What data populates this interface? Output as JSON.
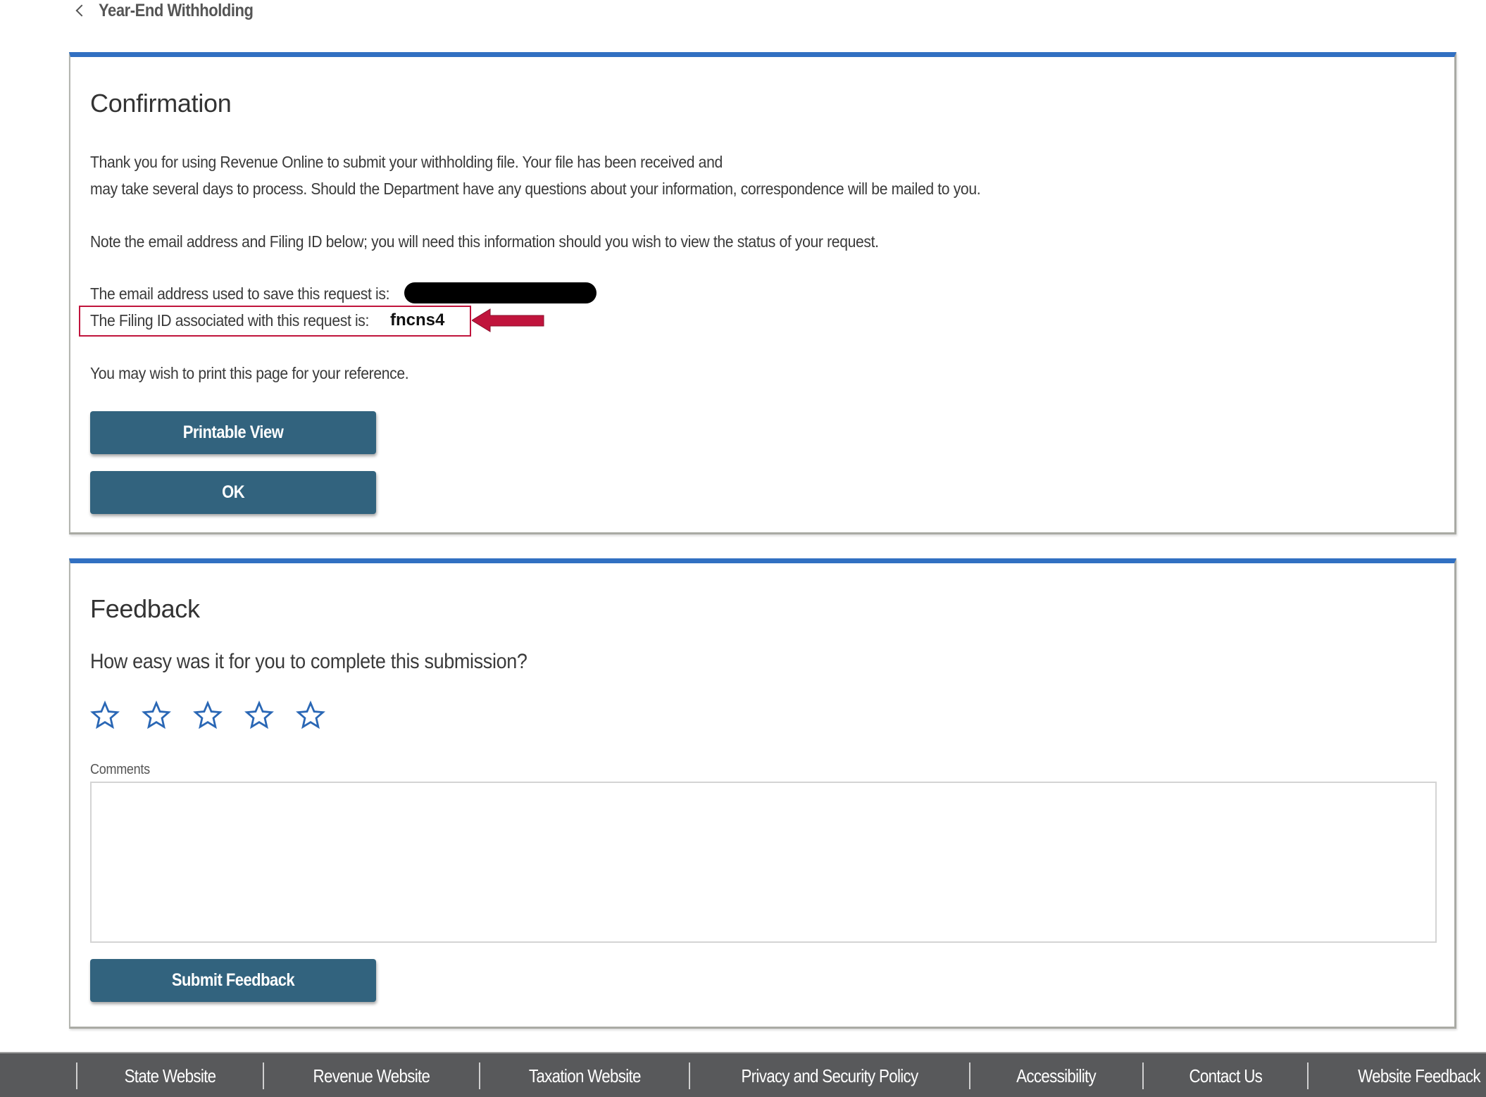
{
  "breadcrumb": {
    "back_icon": "chevron-left-icon",
    "label": "Year-End Withholding"
  },
  "confirmation": {
    "title": "Confirmation",
    "line1": "Thank you for using Revenue Online to submit your withholding file. Your file has been received and",
    "line2": "may take several days to process. Should the Department have any questions about your information, correspondence will be mailed to you.",
    "note": "Note the email address and Filing ID below; you will need this information should you wish to view the status of your request.",
    "email_label": "The email address used to save this request is:",
    "email_value": "[redacted]",
    "filing_label": "The Filing ID associated with this request is:",
    "filing_id": "fncns4",
    "print_note": "You may wish to print this page for your reference.",
    "printable_view_label": "Printable View",
    "ok_label": "OK"
  },
  "annotation": {
    "highlight_color": "#c0143c",
    "arrow_icon": "arrow-left-icon"
  },
  "feedback": {
    "title": "Feedback",
    "question": "How easy was it for you to complete this submission?",
    "rating": {
      "value": 0,
      "max": 5
    },
    "star_icon": "star-outline-icon",
    "comments_label": "Comments",
    "comments_value": "",
    "submit_label": "Submit Feedback"
  },
  "footer": {
    "links": [
      "State Website",
      "Revenue Website",
      "Taxation Website",
      "Privacy and Security Policy",
      "Accessibility",
      "Contact Us",
      "Website Feedback"
    ]
  },
  "colors": {
    "card_accent": "#3170c2",
    "button": "#32637e",
    "footer_bg": "#58595b",
    "star": "#2a67b5"
  }
}
